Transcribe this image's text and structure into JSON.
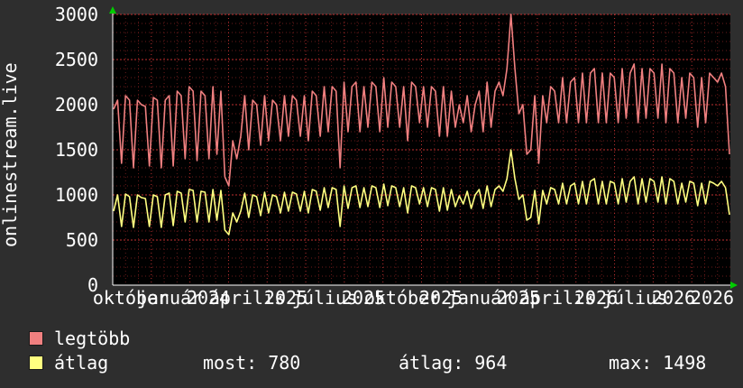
{
  "chart_data": {
    "type": "line",
    "ylabel": "onlinestream.live",
    "ylim": [
      0,
      3000
    ],
    "y_ticks": [
      "0",
      "500",
      "1000",
      "1500",
      "2000",
      "2500",
      "3000"
    ],
    "x_tick_labels": [
      "október",
      "január",
      "2024",
      "április",
      "2025",
      "július",
      "2025",
      "október",
      "2025",
      "január",
      "2025",
      "április",
      "2026",
      "július",
      "2026",
      "2026"
    ],
    "grid": true,
    "legend_placement": "bottom-left",
    "series": [
      {
        "name": "legtöbb",
        "color": "#f08080",
        "values": [
          1950,
          2050,
          1350,
          2100,
          2050,
          1300,
          2050,
          2000,
          1980,
          1320,
          2080,
          2050,
          1300,
          2050,
          2100,
          1320,
          2150,
          2100,
          1400,
          2200,
          2150,
          1380,
          2150,
          2100,
          1400,
          2200,
          1450,
          2150,
          1200,
          1100,
          1600,
          1400,
          1650,
          2100,
          1500,
          2050,
          2000,
          1550,
          2100,
          1600,
          2050,
          2000,
          1600,
          2100,
          1650,
          2100,
          2050,
          1650,
          2100,
          1600,
          2150,
          2100,
          1650,
          2200,
          1700,
          2200,
          2150,
          1300,
          2250,
          1700,
          2200,
          2250,
          1700,
          2200,
          1750,
          2250,
          2200,
          1700,
          2300,
          1750,
          2250,
          2200,
          1750,
          2200,
          1600,
          2250,
          2200,
          1800,
          2200,
          1750,
          2200,
          2150,
          1650,
          2200,
          1650,
          2150,
          1750,
          2000,
          1800,
          2100,
          1700,
          2000,
          2150,
          1700,
          2250,
          1750,
          2150,
          2250,
          2100,
          2400,
          3000,
          2400,
          1900,
          2000,
          1450,
          1500,
          2100,
          1350,
          2100,
          1800,
          2200,
          2150,
          1800,
          2300,
          1800,
          2250,
          2300,
          1800,
          2350,
          1800,
          2350,
          2400,
          1800,
          2350,
          1800,
          2350,
          2300,
          1800,
          2400,
          1850,
          2350,
          2450,
          1800,
          2400,
          1850,
          2400,
          2350,
          1850,
          2450,
          1800,
          2400,
          2350,
          1800,
          2300,
          1850,
          2350,
          2300,
          1750,
          2300,
          1800,
          2350,
          2300,
          2250,
          2350,
          2200,
          1450
        ]
      },
      {
        "name": "átlag",
        "color": "#ffff80",
        "values": [
          820,
          1000,
          650,
          1010,
          980,
          640,
          1000,
          970,
          960,
          650,
          1000,
          980,
          640,
          1000,
          1020,
          660,
          1040,
          1020,
          700,
          1060,
          1050,
          700,
          1040,
          1030,
          700,
          1060,
          720,
          1050,
          610,
          560,
          800,
          700,
          820,
          1020,
          750,
          1000,
          980,
          770,
          1030,
          800,
          1000,
          980,
          800,
          1030,
          820,
          1030,
          1010,
          820,
          1040,
          800,
          1060,
          1040,
          830,
          1080,
          860,
          1080,
          1060,
          650,
          1100,
          850,
          1080,
          1100,
          860,
          1080,
          870,
          1100,
          1080,
          860,
          1120,
          880,
          1100,
          1080,
          870,
          1080,
          800,
          1100,
          1080,
          900,
          1080,
          870,
          1080,
          1060,
          820,
          1080,
          830,
          1060,
          870,
          990,
          900,
          1040,
          850,
          1000,
          1060,
          850,
          1100,
          870,
          1060,
          1100,
          1040,
          1180,
          1498,
          1180,
          950,
          1000,
          720,
          750,
          1050,
          680,
          1050,
          900,
          1080,
          1060,
          900,
          1130,
          900,
          1100,
          1130,
          900,
          1150,
          900,
          1150,
          1180,
          900,
          1150,
          900,
          1150,
          1130,
          900,
          1180,
          920,
          1150,
          1200,
          900,
          1180,
          920,
          1180,
          1150,
          920,
          1200,
          900,
          1180,
          1150,
          900,
          1130,
          920,
          1150,
          1130,
          880,
          1130,
          900,
          1150,
          1130,
          1100,
          1150,
          1080,
          780
        ]
      }
    ],
    "legend": [
      {
        "label": "legtöbb",
        "color": "#f08080"
      },
      {
        "label": "átlag",
        "color": "#ffff80",
        "stats": [
          {
            "key": "most:",
            "value": "780"
          },
          {
            "key": "átlag:",
            "value": "964"
          },
          {
            "key": "max:",
            "value": "1498"
          }
        ]
      }
    ],
    "colors": {
      "background": "#2e2e2e",
      "plot": "#000000",
      "grid": "#b02020",
      "arrow": "#00cc00"
    }
  }
}
